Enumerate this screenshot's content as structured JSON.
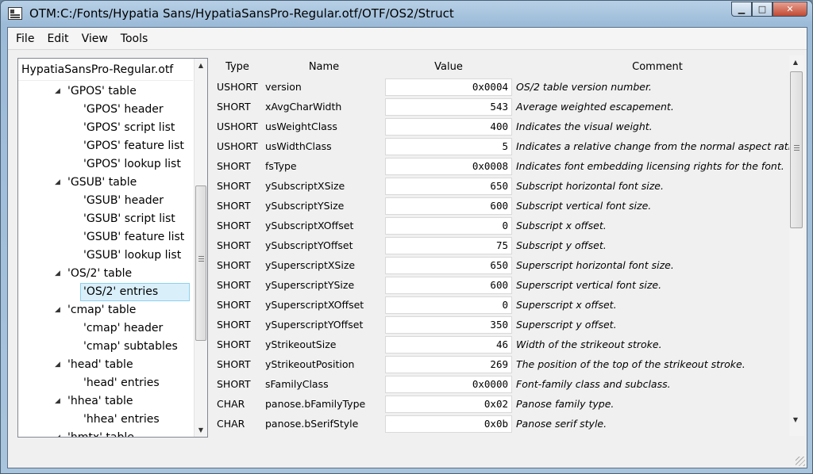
{
  "window": {
    "title": "OTM:C:/Fonts/Hypatia Sans/HypatiaSansPro-Regular.otf/OTF/OS2/Struct",
    "minimize": "▁",
    "maximize": "□",
    "close": "✕"
  },
  "menu": [
    "File",
    "Edit",
    "View",
    "Tools"
  ],
  "tree": {
    "root": "HypatiaSansPro-Regular.otf",
    "items": [
      {
        "label": "'GPOS' table",
        "level": 1,
        "expanded": true
      },
      {
        "label": "'GPOS' header",
        "level": 2
      },
      {
        "label": "'GPOS' script list",
        "level": 2
      },
      {
        "label": "'GPOS' feature list",
        "level": 2
      },
      {
        "label": "'GPOS' lookup list",
        "level": 2
      },
      {
        "label": "'GSUB' table",
        "level": 1,
        "expanded": true
      },
      {
        "label": "'GSUB' header",
        "level": 2
      },
      {
        "label": "'GSUB' script list",
        "level": 2
      },
      {
        "label": "'GSUB' feature list",
        "level": 2
      },
      {
        "label": "'GSUB' lookup list",
        "level": 2
      },
      {
        "label": "'OS/2' table",
        "level": 1,
        "expanded": true
      },
      {
        "label": "'OS/2' entries",
        "level": 2,
        "selected": true
      },
      {
        "label": "'cmap' table",
        "level": 1,
        "expanded": true
      },
      {
        "label": "'cmap' header",
        "level": 2
      },
      {
        "label": "'cmap' subtables",
        "level": 2
      },
      {
        "label": "'head' table",
        "level": 1,
        "expanded": true
      },
      {
        "label": "'head' entries",
        "level": 2
      },
      {
        "label": "'hhea' table",
        "level": 1,
        "expanded": true
      },
      {
        "label": "'hhea' entries",
        "level": 2
      },
      {
        "label": "'hmtx' table",
        "level": 1,
        "expanded": true
      }
    ]
  },
  "grid": {
    "headers": {
      "type": "Type",
      "name": "Name",
      "value": "Value",
      "comment": "Comment"
    },
    "rows": [
      {
        "type": "USHORT",
        "name": "version",
        "value": "0x0004",
        "comment": "OS/2 table version number."
      },
      {
        "type": "SHORT",
        "name": "xAvgCharWidth",
        "value": "543",
        "comment": "Average weighted escapement."
      },
      {
        "type": "USHORT",
        "name": "usWeightClass",
        "value": "400",
        "comment": "Indicates the visual weight."
      },
      {
        "type": "USHORT",
        "name": "usWidthClass",
        "value": "5",
        "comment": "Indicates a relative change from the normal aspect ratio."
      },
      {
        "type": "SHORT",
        "name": "fsType",
        "value": "0x0008",
        "comment": "Indicates font embedding licensing rights for the font."
      },
      {
        "type": "SHORT",
        "name": "ySubscriptXSize",
        "value": "650",
        "comment": "Subscript horizontal font size."
      },
      {
        "type": "SHORT",
        "name": "ySubscriptYSize",
        "value": "600",
        "comment": "Subscript vertical font size."
      },
      {
        "type": "SHORT",
        "name": "ySubscriptXOffset",
        "value": "0",
        "comment": "Subscript x offset."
      },
      {
        "type": "SHORT",
        "name": "ySubscriptYOffset",
        "value": "75",
        "comment": "Subscript y offset."
      },
      {
        "type": "SHORT",
        "name": "ySuperscriptXSize",
        "value": "650",
        "comment": "Superscript horizontal font size."
      },
      {
        "type": "SHORT",
        "name": "ySuperscriptYSize",
        "value": "600",
        "comment": "Superscript vertical font size."
      },
      {
        "type": "SHORT",
        "name": "ySuperscriptXOffset",
        "value": "0",
        "comment": "Superscript x offset."
      },
      {
        "type": "SHORT",
        "name": "ySuperscriptYOffset",
        "value": "350",
        "comment": "Superscript y offset."
      },
      {
        "type": "SHORT",
        "name": "yStrikeoutSize",
        "value": "46",
        "comment": "Width of the strikeout stroke."
      },
      {
        "type": "SHORT",
        "name": "yStrikeoutPosition",
        "value": "269",
        "comment": "The position of the top of the strikeout stroke."
      },
      {
        "type": "SHORT",
        "name": "sFamilyClass",
        "value": "0x0000",
        "comment": "Font-family class and subclass."
      },
      {
        "type": "CHAR",
        "name": "panose.bFamilyType",
        "value": "0x02",
        "comment": "Panose family type."
      },
      {
        "type": "CHAR",
        "name": "panose.bSerifStyle",
        "value": "0x0b",
        "comment": "Panose serif style."
      }
    ]
  },
  "icons": {
    "scroll_up": "▲",
    "scroll_down": "▼",
    "tree_expanded": "◢"
  },
  "colors": {
    "selection_bg": "#d9f0fb",
    "selection_border": "#8ed0ee",
    "close_button": "#c14a33"
  }
}
